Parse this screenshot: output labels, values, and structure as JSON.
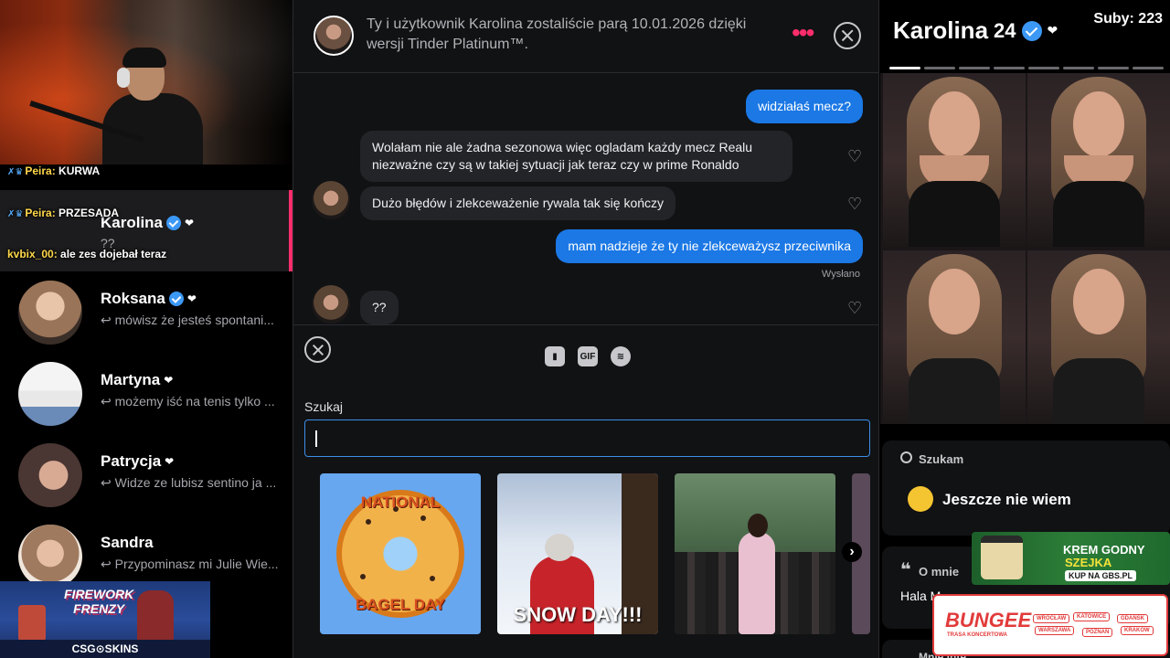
{
  "stream": {
    "webcam_label": "streamer webcam",
    "chat_overlay": [
      {
        "nick": "Peira:",
        "text": "KURWA"
      },
      {
        "nick": "Peira:",
        "text": "PRZESADA"
      },
      {
        "nick": "kvbix_00:",
        "text": "ale zes dojebał teraz"
      }
    ],
    "subs": "Suby: 223"
  },
  "matches": [
    {
      "name": "Karolina",
      "message": "??",
      "active": true
    },
    {
      "name": "Roksana",
      "message": "↩ mówisz że jesteś spontani...",
      "active": false
    },
    {
      "name": "Martyna",
      "message": "↩ możemy iść na tenis tylko ...",
      "active": false
    },
    {
      "name": "Patrycja",
      "message": "↩ Widze ze lubisz sentino ja ...",
      "active": false
    },
    {
      "name": "Sandra",
      "message": "↩ Przypominasz mi Julie Wie...",
      "active": false
    }
  ],
  "ads": {
    "left_title_1": "FIREWORK",
    "left_title_2": "FRENZY",
    "left_footer": "CSG⊙SKINS",
    "cream_1": "KREM GODNY",
    "cream_2": "SZEJKA",
    "cream_3": "KUP NA GBS.PL",
    "bungee_brand": "BUNGEE",
    "bungee_tag": "TRASA KONCERTOWA",
    "bungee_cities": [
      "WROCŁAW",
      "KATOWICE",
      "GDAŃSK",
      "WARSZAWA",
      "POZNAŃ",
      "KRAKÓW"
    ]
  },
  "chat": {
    "header_text": "Ty i użytkownik Karolina zostaliście parą 10.01.2026 dzięki wersji Tinder Platinum™.",
    "messages": [
      {
        "dir": "out",
        "text": "widziałaś mecz?"
      },
      {
        "dir": "in",
        "text": "Wolałam nie ale żadna sezonowa więc ogladam każdy mecz Realu niezważne czy są w takiej sytuacji jak teraz czy w prime Ronaldo"
      },
      {
        "dir": "in",
        "text": "Dużo błędów i zlekceważenie rywala tak się kończy"
      },
      {
        "dir": "out",
        "text": "mam nadzieje że ty nie zlekceważysz przeciwnika"
      },
      {
        "dir": "in",
        "text": "??"
      }
    ],
    "sent_label": "Wysłano"
  },
  "composer": {
    "media": {
      "gif_label": "GIF"
    },
    "search_label": "Szukaj",
    "search_value": "",
    "gifs": [
      {
        "name": "national-bagel-day",
        "caption_top": "NATIONAL",
        "caption_bottom": "BAGEL DAY"
      },
      {
        "name": "snow-day",
        "caption": "SNOW DAY!!!"
      },
      {
        "name": "dancing-crowd",
        "caption": ""
      }
    ]
  },
  "profile": {
    "name": "Karolina",
    "age": "24",
    "photo_count": 8,
    "active_photo": 0,
    "looking_label": "Szukam",
    "looking_value": "Jeszcze nie wiem",
    "about_label": "O mnie",
    "about_value": "Hala M",
    "more_label": "Mnie inte"
  },
  "colors": {
    "accent": "#fd2d6b",
    "outgoing_bubble": "#1b78e5",
    "incoming_bubble": "#232428",
    "verified": "#3b98f5"
  }
}
